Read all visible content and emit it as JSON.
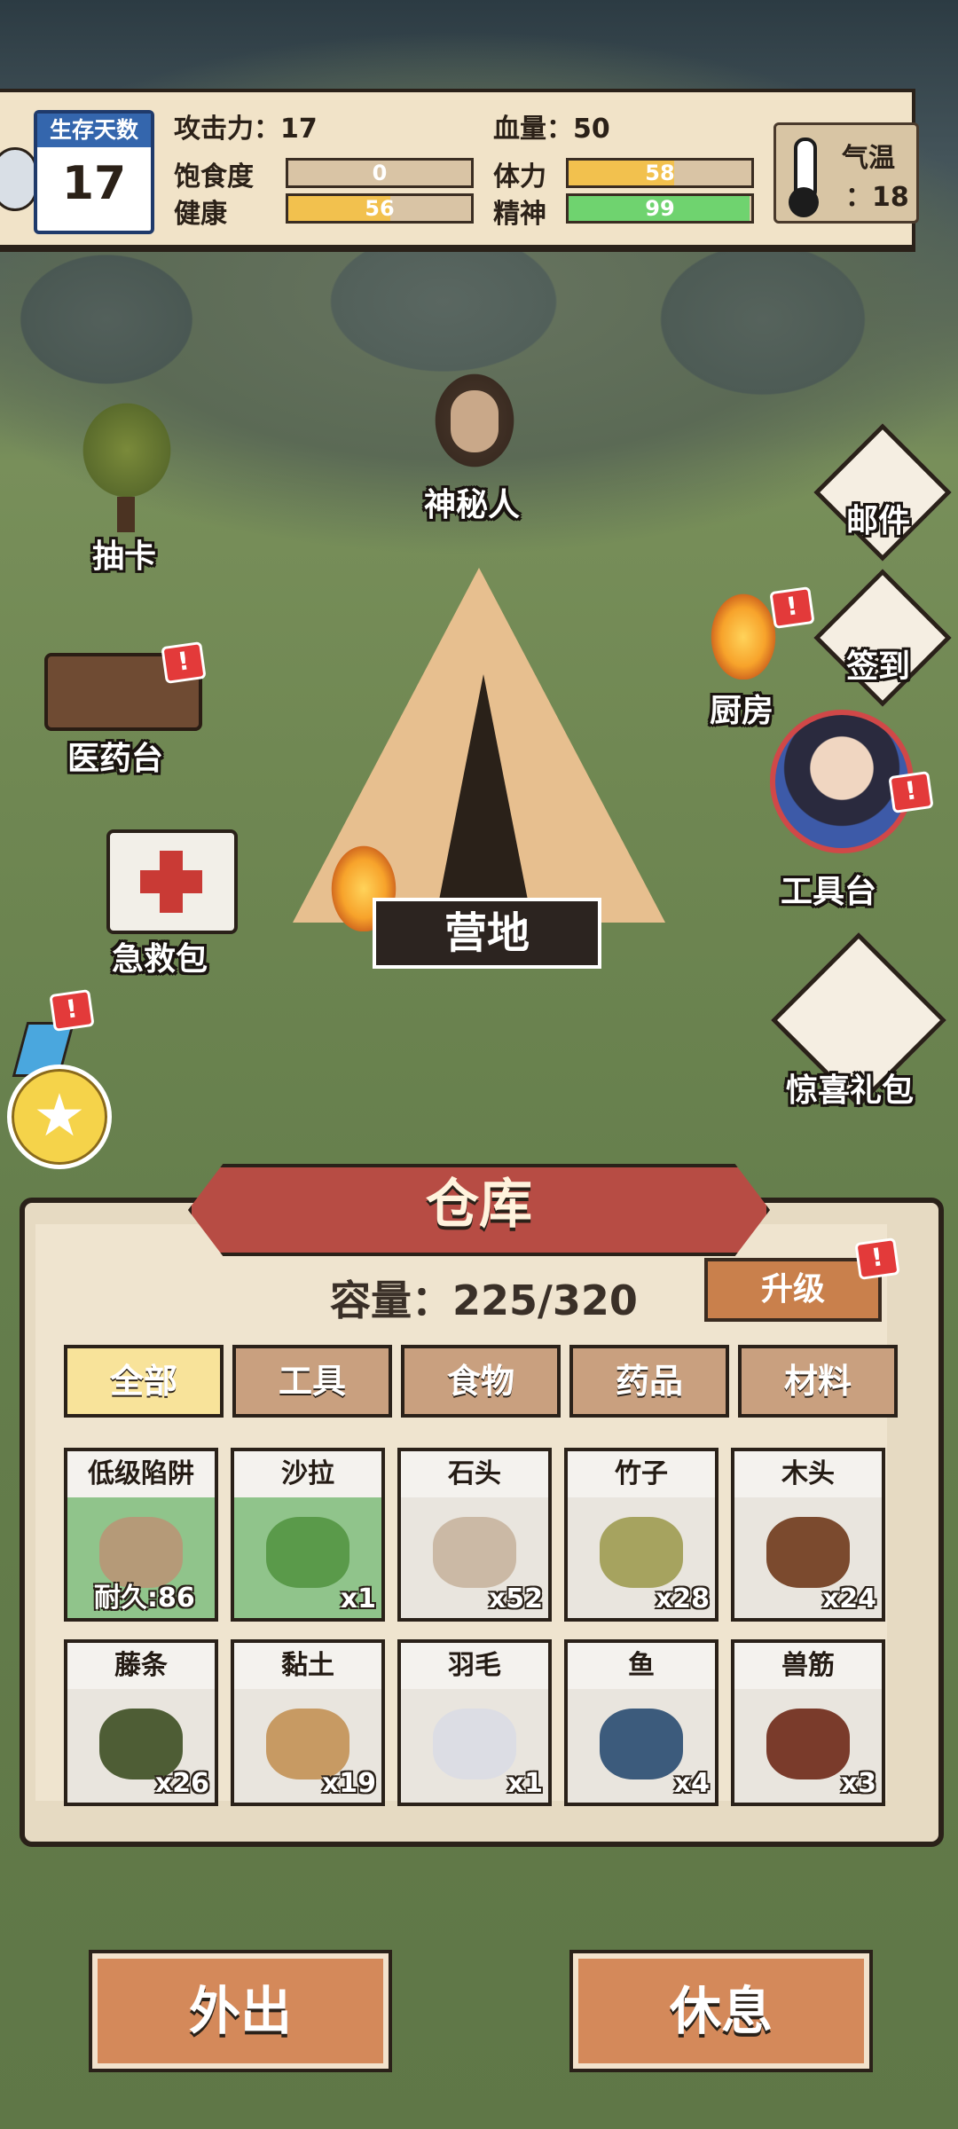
{
  "survival": {
    "label": "生存天数",
    "days": "17"
  },
  "stats": {
    "attack_label": "攻击力：17",
    "hp_label": "血量：50",
    "satiety": {
      "label": "饱食度",
      "value": "0",
      "fraction": 0.0,
      "color": "#d9c4a5"
    },
    "health": {
      "label": "健康",
      "value": "56",
      "fraction": 0.56,
      "color": "#f2c14e"
    },
    "stamina": {
      "label": "体力",
      "value": "58",
      "fraction": 0.58,
      "color": "#f2c14e"
    },
    "spirit": {
      "label": "精神",
      "value": "99",
      "fraction": 0.99,
      "color": "#6fd36f"
    }
  },
  "temperature": {
    "label": "气温",
    "value": "：18"
  },
  "map": {
    "gacha_label": "抽卡",
    "npc_label": "神秘人",
    "mail_label": "邮件",
    "signin_label": "签到",
    "medicine_label": "医药台",
    "kitchen_label": "厨房",
    "firstaid_label": "急救包",
    "camp_label": "营地",
    "toolbench_label": "工具台",
    "gift_label": "惊喜礼包",
    "badge": "!"
  },
  "warehouse": {
    "title": "仓库",
    "capacity": "容量：225/320",
    "upgrade_label": "升级",
    "tabs": [
      "全部",
      "工具",
      "食物",
      "药品",
      "材料"
    ],
    "items": [
      {
        "name": "低级陷阱",
        "count": "耐久:86",
        "art": "#b59a78",
        "green": true
      },
      {
        "name": "沙拉",
        "count": "x1",
        "art": "#5a9a4a",
        "green": true
      },
      {
        "name": "石头",
        "count": "x52",
        "art": "#cbb9a5",
        "green": false
      },
      {
        "name": "竹子",
        "count": "x28",
        "art": "#a6a35f",
        "green": false
      },
      {
        "name": "木头",
        "count": "x24",
        "art": "#7b4a2e",
        "green": false
      },
      {
        "name": "藤条",
        "count": "x26",
        "art": "#4e5d35",
        "green": false
      },
      {
        "name": "黏土",
        "count": "x19",
        "art": "#c79a63",
        "green": false
      },
      {
        "name": "羽毛",
        "count": "x1",
        "art": "#dcdde4",
        "green": false
      },
      {
        "name": "鱼",
        "count": "x4",
        "art": "#3c5b7c",
        "green": false
      },
      {
        "name": "兽筋",
        "count": "x3",
        "art": "#7a3b2b",
        "green": false
      }
    ]
  },
  "actions": {
    "go_out": "外出",
    "rest": "休息"
  }
}
